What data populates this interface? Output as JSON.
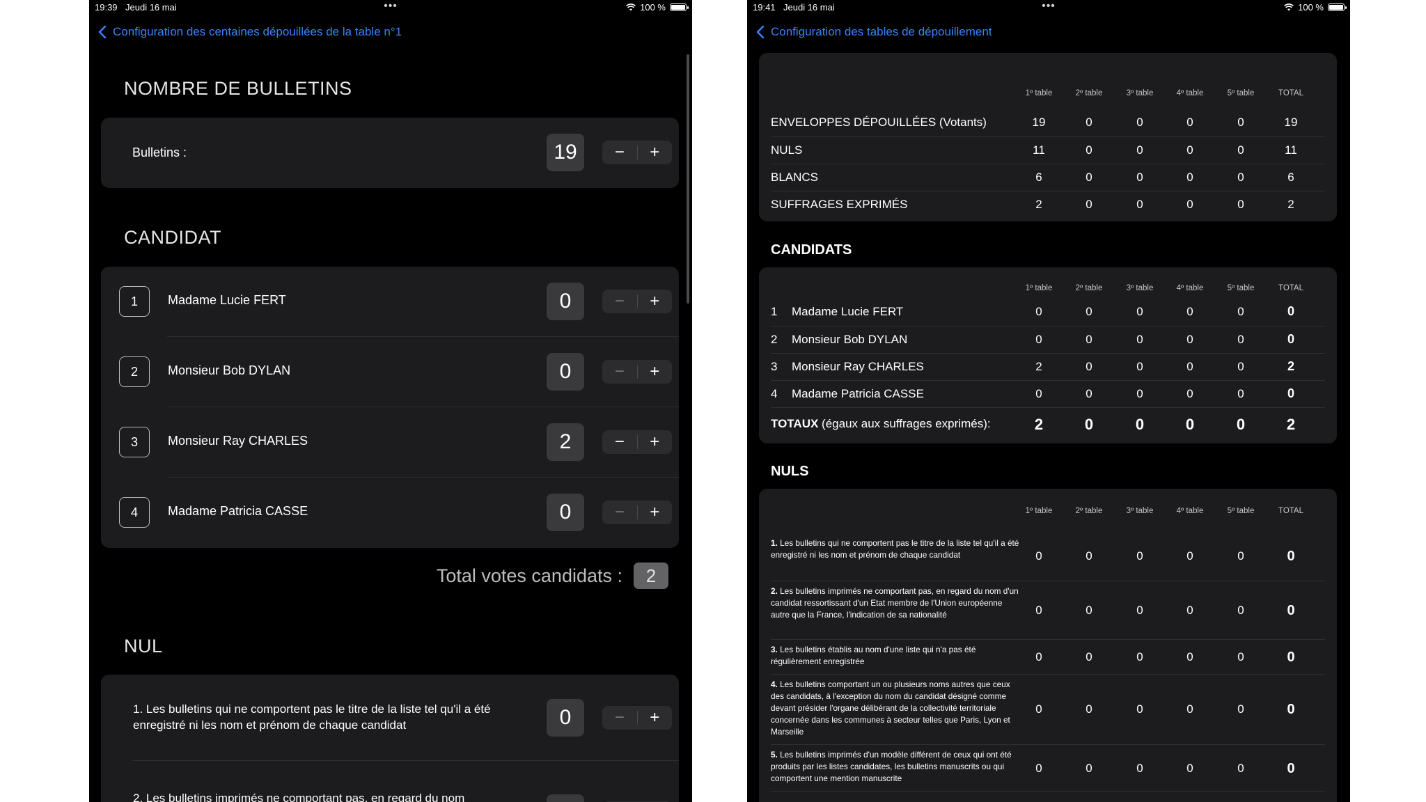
{
  "left": {
    "status": {
      "time": "19:39",
      "date": "Jeudi 16 mai",
      "battery": "100 %"
    },
    "back_label": "Configuration des centaines dépouillées de la table n°1",
    "bulletins": {
      "section_title": "NOMBRE DE BULLETINS",
      "label": "Bulletins :",
      "value": "19"
    },
    "candidat_title": "CANDIDAT",
    "candidates": [
      {
        "num": "1",
        "name": "Madame Lucie FERT",
        "value": "0"
      },
      {
        "num": "2",
        "name": "Monsieur Bob DYLAN",
        "value": "0"
      },
      {
        "num": "3",
        "name": "Monsieur Ray CHARLES",
        "value": "2"
      },
      {
        "num": "4",
        "name": "Madame Patricia CASSE",
        "value": "0"
      }
    ],
    "total": {
      "label": "Total votes candidats :",
      "value": "2"
    },
    "nul_title": "NUL",
    "nuls": [
      {
        "text": "1. Les bulletins qui ne comportent pas le titre de la liste tel qu'il a été enregistré ni les nom et prénom de chaque candidat",
        "value": "0"
      },
      {
        "text": "2. Les bulletins imprimés ne comportant pas, en regard du nom",
        "value": ""
      }
    ],
    "stepper": {
      "minus": "−",
      "plus": "+"
    }
  },
  "right": {
    "status": {
      "time": "19:41",
      "date": "Jeudi 16 mai",
      "battery": "100 %"
    },
    "back_label": "Configuration des tables de dépouillement",
    "columns": [
      "1º table",
      "2º table",
      "3º table",
      "4º table",
      "5º table",
      "TOTAL"
    ],
    "summary": [
      {
        "label": "ENVELOPPES DÉPOUILLÉES (Votants)",
        "values": [
          "19",
          "0",
          "0",
          "0",
          "0",
          "19"
        ]
      },
      {
        "label": "NULS",
        "values": [
          "11",
          "0",
          "0",
          "0",
          "0",
          "11"
        ]
      },
      {
        "label": "BLANCS",
        "values": [
          "6",
          "0",
          "0",
          "0",
          "0",
          "6"
        ]
      },
      {
        "label": "SUFFRAGES EXPRIMÉS",
        "values": [
          "2",
          "0",
          "0",
          "0",
          "0",
          "2"
        ]
      }
    ],
    "candidats_title": "CANDIDATS",
    "candidats": [
      {
        "num": "1",
        "name": "Madame Lucie FERT",
        "values": [
          "0",
          "0",
          "0",
          "0",
          "0",
          "0"
        ]
      },
      {
        "num": "2",
        "name": "Monsieur Bob DYLAN",
        "values": [
          "0",
          "0",
          "0",
          "0",
          "0",
          "0"
        ]
      },
      {
        "num": "3",
        "name": "Monsieur Ray CHARLES",
        "values": [
          "2",
          "0",
          "0",
          "0",
          "0",
          "2"
        ]
      },
      {
        "num": "4",
        "name": "Madame Patricia CASSE",
        "values": [
          "0",
          "0",
          "0",
          "0",
          "0",
          "0"
        ]
      }
    ],
    "totaux": {
      "label_bold": "TOTAUX",
      "label_rest": " (égaux aux suffrages exprimés):",
      "values": [
        "2",
        "0",
        "0",
        "0",
        "0",
        "2"
      ]
    },
    "nuls_title": "NULS",
    "nuls": [
      {
        "num": "1.",
        "text": " Les bulletins qui ne comportent pas le titre de la liste tel qu'il a été enregistré ni les nom et prénom de chaque candidat",
        "values": [
          "0",
          "0",
          "0",
          "0",
          "0",
          "0"
        ]
      },
      {
        "num": "2.",
        "text": " Les bulletins imprimés ne comportant pas, en regard du nom d'un candidat ressortissant d'un Etat membre de l'Union européenne autre que la France, l'indication de sa nationalité",
        "values": [
          "0",
          "0",
          "0",
          "0",
          "0",
          "0"
        ]
      },
      {
        "num": "3.",
        "text": " Les bulletins établis au nom d'une liste qui n'a pas été régulièrement enregistrée",
        "values": [
          "0",
          "0",
          "0",
          "0",
          "0",
          "0"
        ]
      },
      {
        "num": "4.",
        "text": " Les bulletins comportant un ou plusieurs noms autres que ceux des candidats, à l'exception du nom du candidat désigné comme devant présider l'organe délibérant de la collectivité territoriale concernée dans les communes à secteur telles que Paris, Lyon et Marseille",
        "values": [
          "0",
          "0",
          "0",
          "0",
          "0",
          "0"
        ]
      },
      {
        "num": "5.",
        "text": " Les bulletins imprimés d'un modèle différent de ceux qui ont été produits par les listes candidates, les bulletins manuscrits ou qui comportent une mention manuscrite",
        "values": [
          "0",
          "0",
          "0",
          "0",
          "0",
          "0"
        ]
      }
    ]
  }
}
